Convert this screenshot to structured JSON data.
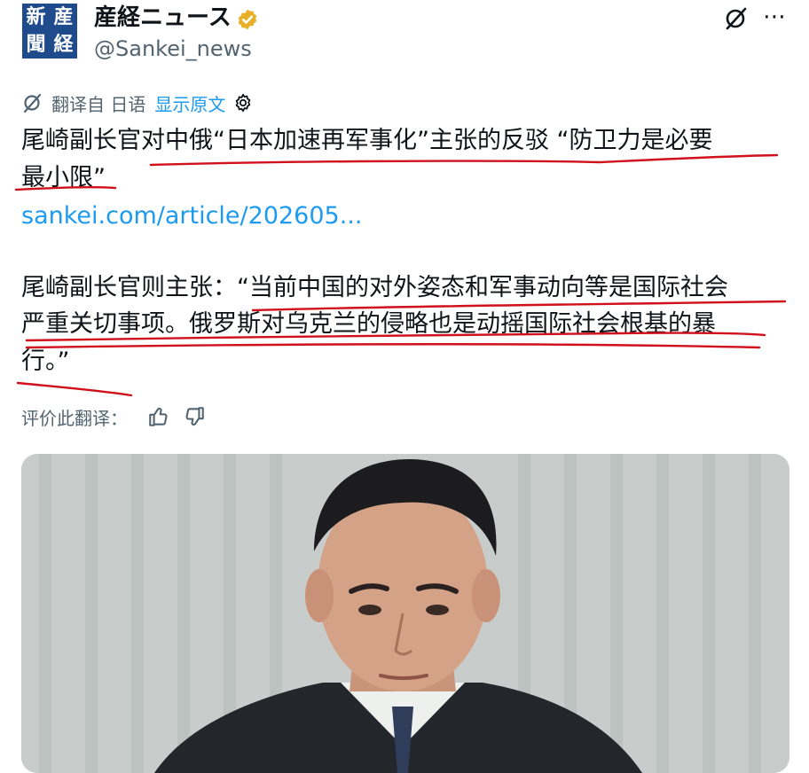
{
  "post": {
    "author": {
      "display_name": "産経ニュース",
      "handle": "@Sankei_news",
      "avatar_chars": [
        "新",
        "産",
        "聞",
        "経"
      ],
      "verified_color": "#E8B028"
    },
    "translation": {
      "label": "翻译自 日语",
      "show_original": "显示原文"
    },
    "headline_lines": [
      "尾崎副长官对中俄“日本加速再军事化”主张的反驳 “防卫力是必要",
      "最小限”"
    ],
    "link": "sankei.com/article/202605...",
    "body_lines": [
      "尾崎副长官则主张：“当前中国的对外姿态和军事动向等是国际社会",
      "严重关切事项。俄罗斯对乌克兰的侵略也是动摇国际社会根基的暴",
      "行。”"
    ],
    "rate_label": "评价此翻译：",
    "media": {
      "description": "photo"
    }
  },
  "icons": [
    "grok-icon",
    "more-icon",
    "translate-icon",
    "gear-icon",
    "thumbs-up-icon",
    "thumbs-down-icon",
    "verified-badge-icon"
  ],
  "colors": {
    "link": "#1D9BF0",
    "secondary_text": "#536471",
    "annotation_underline": "#D0101A",
    "avatar_bg": "#1F4A8C"
  }
}
